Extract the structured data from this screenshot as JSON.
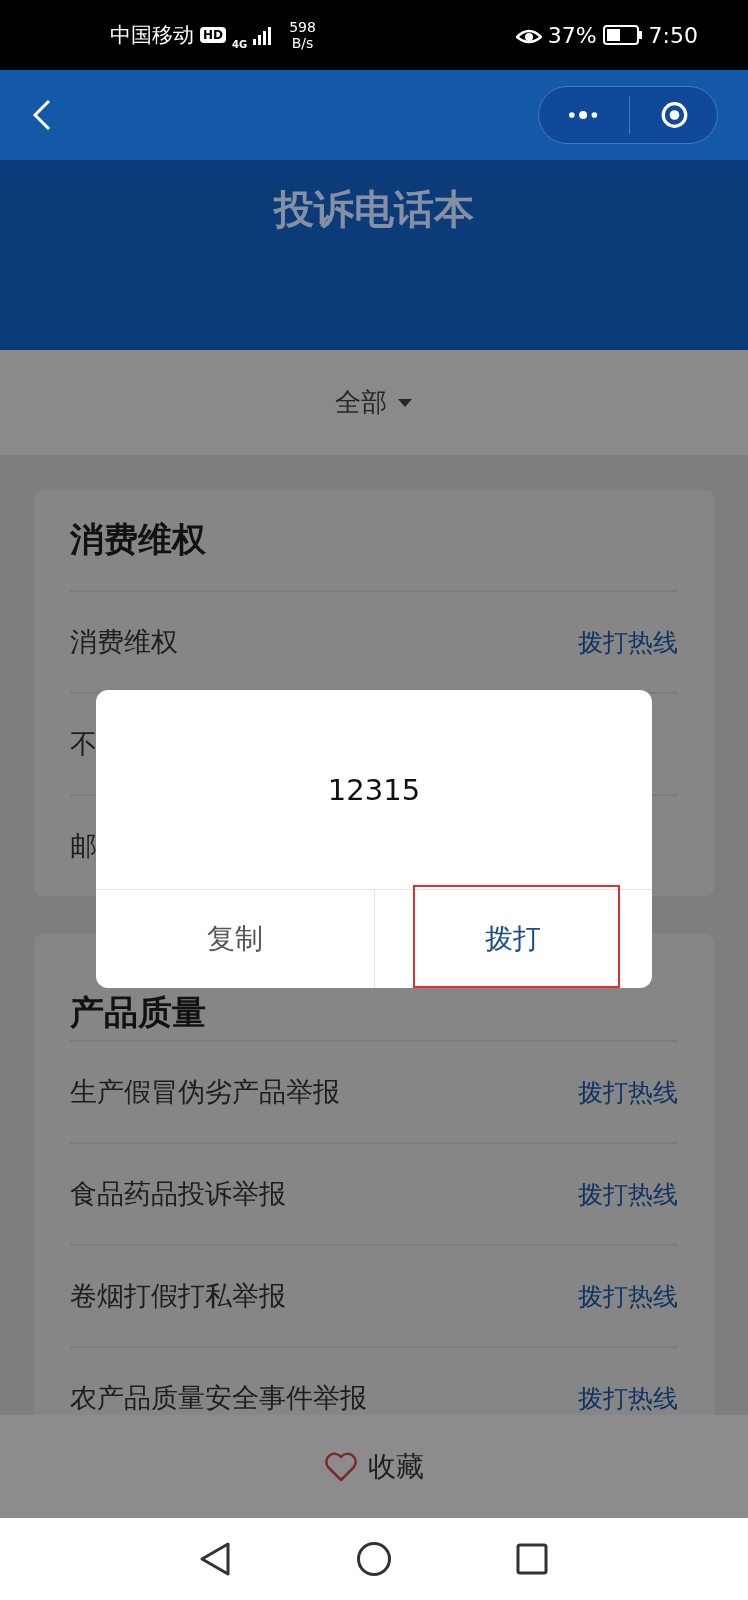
{
  "status_bar": {
    "carrier": "中国移动",
    "hd": "HD",
    "network": "4G",
    "speed": "598",
    "speed_unit": "B/s",
    "battery": "37%",
    "time": "7:50"
  },
  "header": {
    "title": "投诉电话本"
  },
  "filter": {
    "label": "全部"
  },
  "sections": [
    {
      "title": "消费维权",
      "rows": [
        {
          "name": "消费维权",
          "action": "拨打热线"
        },
        {
          "name": "不"
        },
        {
          "name": "邮"
        }
      ]
    },
    {
      "title": "产品质量",
      "rows": [
        {
          "name": "生产假冒伪劣产品举报",
          "action": "拨打热线"
        },
        {
          "name": "食品药品投诉举报",
          "action": "拨打热线"
        },
        {
          "name": "卷烟打假打私举报",
          "action": "拨打热线"
        },
        {
          "name": "农产品质量安全事件举报",
          "action": "拨打热线"
        }
      ]
    }
  ],
  "dialog": {
    "number": "12315",
    "buttons": [
      {
        "label": "复制",
        "kind": "copy",
        "highlighted": false
      },
      {
        "label": "拨打",
        "kind": "call",
        "highlighted": true
      }
    ]
  },
  "bottom_bar": {
    "label": "收藏"
  }
}
